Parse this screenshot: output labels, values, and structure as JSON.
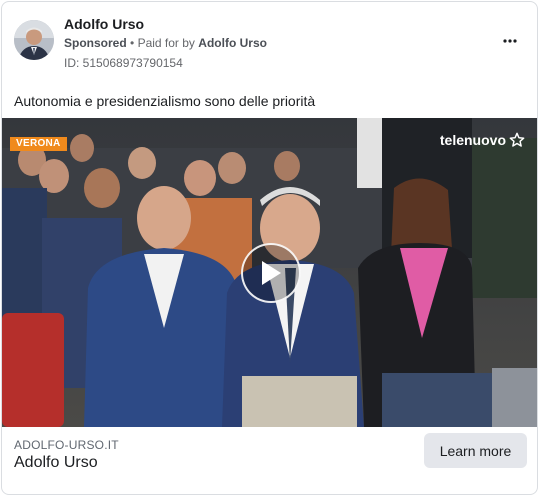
{
  "advertiser": {
    "name": "Adolfo Urso",
    "sponsored_label": "Sponsored",
    "separator": "•",
    "paid_for_prefix": "Paid for by",
    "paid_for_name": "Adolfo Urso",
    "ad_id": "ID: 515068973790154"
  },
  "ad_text": "Autonomia e presidenzialismo sono delle priorità",
  "media": {
    "location_tag": "VERONA",
    "brand_logo_text": "telenuovo"
  },
  "link": {
    "domain": "ADOLFO-URSO.IT",
    "title": "Adolfo Urso",
    "cta_label": "Learn more"
  },
  "icons": {
    "more": "more-options-icon",
    "play": "play-icon",
    "star": "star-icon"
  },
  "colors": {
    "accent_tag": "#f08a1c",
    "cta_bg": "#e4e6eb",
    "muted_text": "#65676b"
  }
}
